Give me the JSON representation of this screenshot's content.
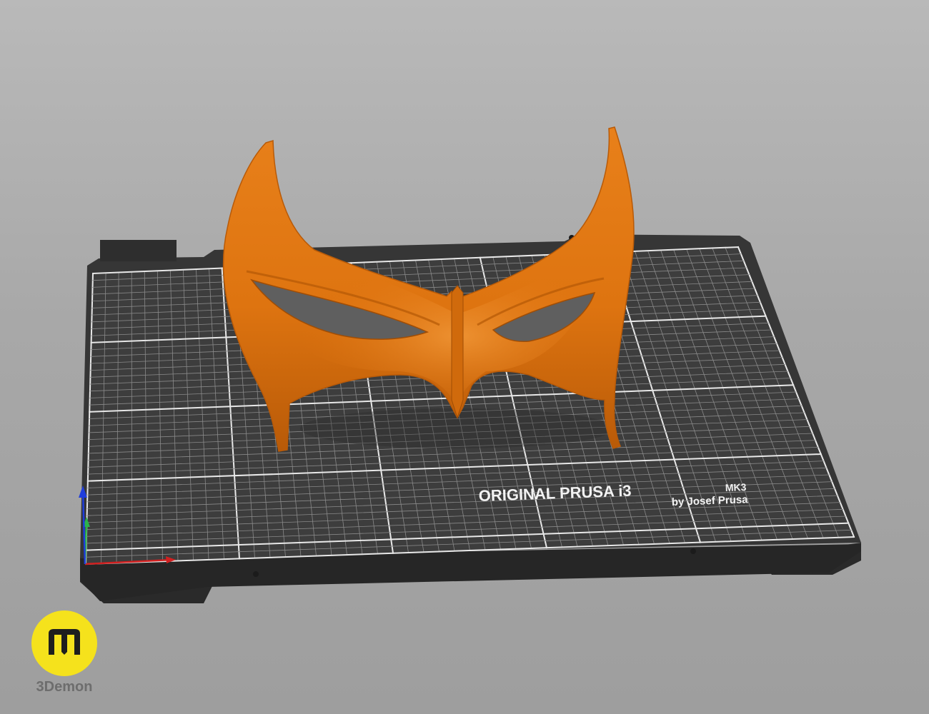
{
  "app": {
    "view": "3D print preview",
    "bed": {
      "brand_line": "ORIGINAL PRUSA i3",
      "model": "MK3",
      "maker": "by Josef Prusa"
    },
    "model": {
      "name": "mask",
      "color": "#e07410"
    },
    "axes": {
      "x_color": "#d12020",
      "y_color": "#2cb34a",
      "z_color": "#1f3ddb"
    }
  },
  "branding": {
    "logo_icon": "m-logo-icon",
    "name": "3Demon",
    "logo_color": "#f5e21c"
  }
}
